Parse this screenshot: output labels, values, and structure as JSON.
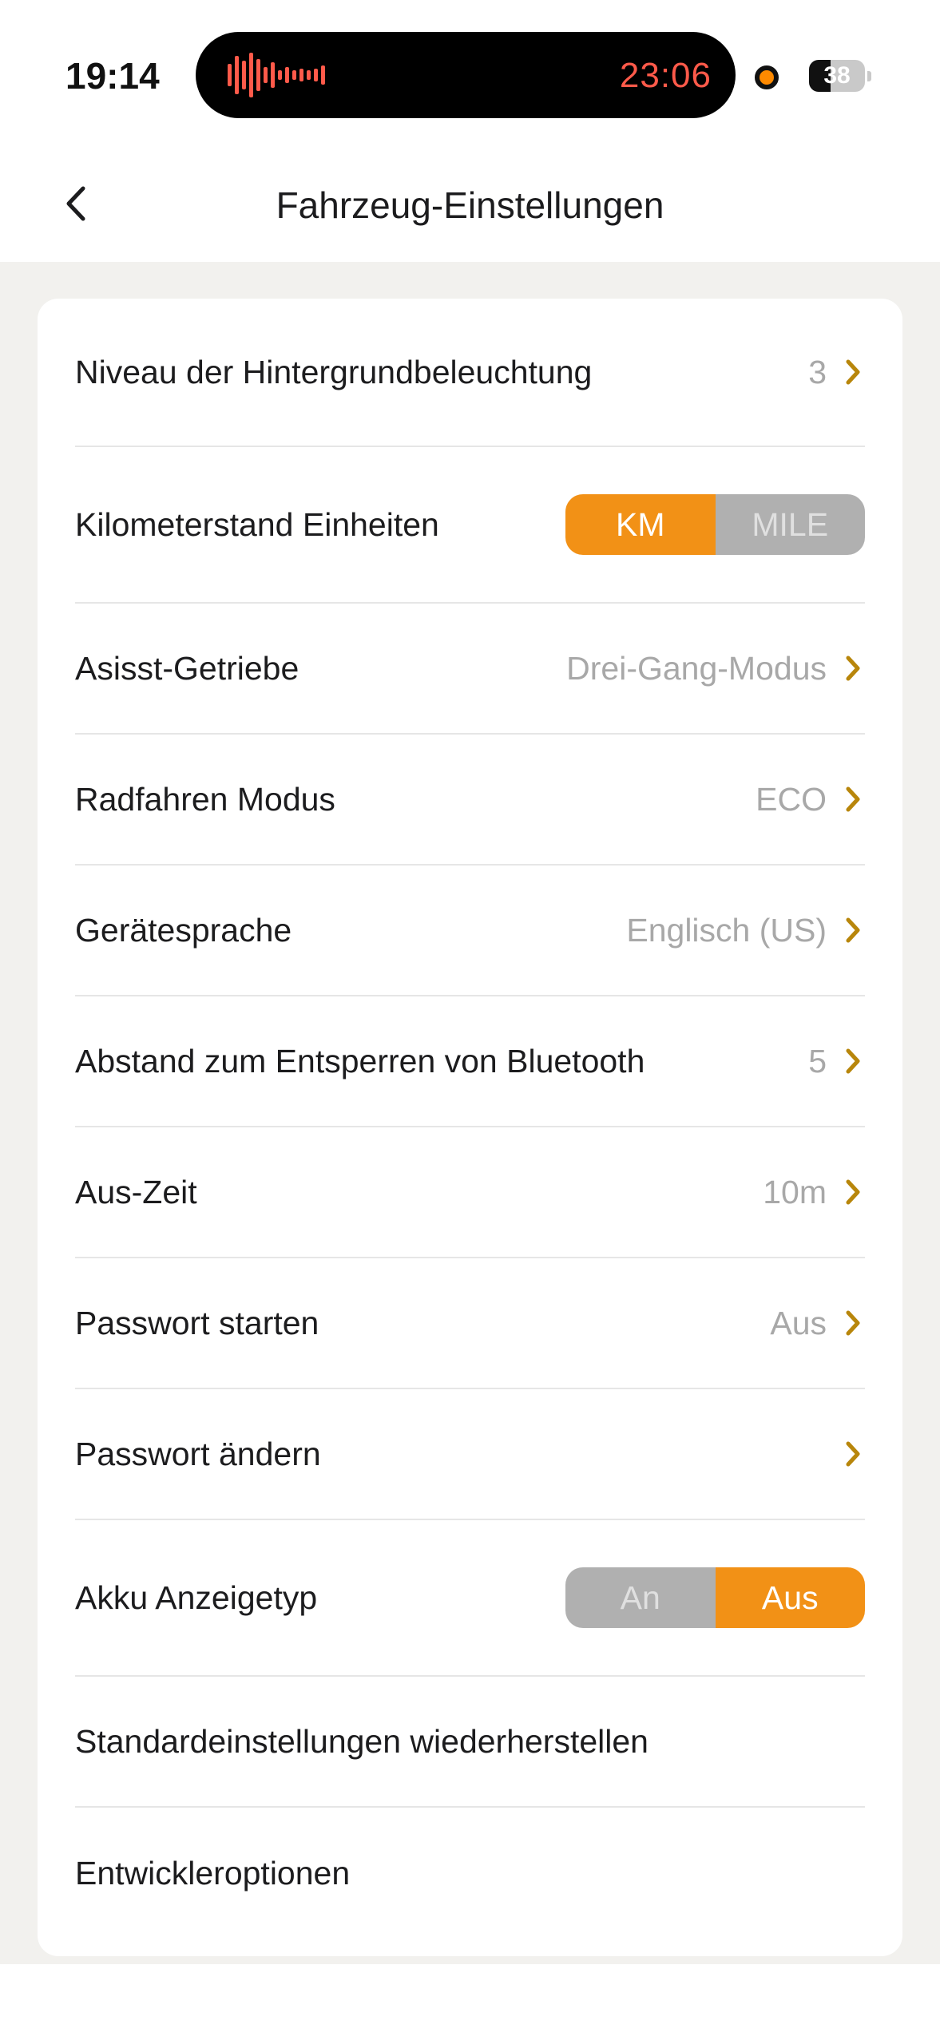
{
  "status_bar": {
    "time": "19:14",
    "timer": "23:06",
    "battery": "38",
    "battery_level": 0.38,
    "timer_color": "#ff5a4a",
    "recording_dot_color": "#ff8a00"
  },
  "nav": {
    "title": "Fahrzeug-Einstellungen",
    "back_icon": "chevron-left-icon"
  },
  "settings": {
    "backlight": {
      "label": "Niveau der Hintergrundbeleuchtung",
      "value": "3"
    },
    "odometer": {
      "label": "Kilometerstand Einheiten",
      "options": [
        "KM",
        "MILE"
      ],
      "selected": "KM"
    },
    "assist_gear": {
      "label": "Asisst-Getriebe",
      "value": "Drei-Gang-Modus"
    },
    "riding_mode": {
      "label": "Radfahren Modus",
      "value": "ECO"
    },
    "device_language": {
      "label": "Gerätesprache",
      "value": "Englisch (US)"
    },
    "bluetooth_unlock": {
      "label": "Abstand zum Entsperren von Bluetooth",
      "value": "5"
    },
    "off_time": {
      "label": "Aus-Zeit",
      "value": "10m"
    },
    "start_password": {
      "label": "Passwort starten",
      "value": "Aus"
    },
    "change_password": {
      "label": "Passwort ändern"
    },
    "battery_display": {
      "label": "Akku Anzeigetyp",
      "options": [
        "An",
        "Aus"
      ],
      "selected": "Aus"
    },
    "restore_defaults": {
      "label": "Standardeinstellungen wiederherstellen"
    },
    "developer_options": {
      "label": "Entwickleroptionen"
    }
  },
  "colors": {
    "accent": "#f29116",
    "chevron": "#b8860b",
    "inactive_segment": "#b0b0b0",
    "value_text": "#a8a8a8",
    "page_background": "#f2f1ee"
  }
}
